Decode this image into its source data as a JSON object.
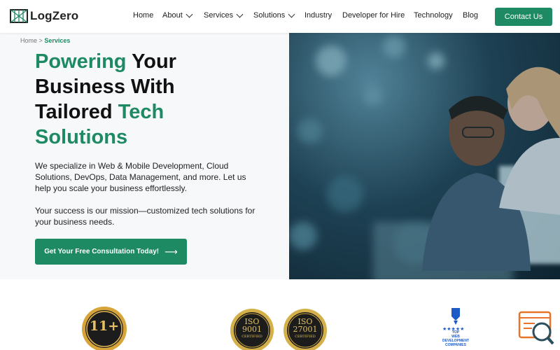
{
  "brand": {
    "name": "LogZero"
  },
  "nav": {
    "items": [
      {
        "label": "Home",
        "dropdown": false
      },
      {
        "label": "About",
        "dropdown": true
      },
      {
        "label": "Services",
        "dropdown": true
      },
      {
        "label": "Solutions",
        "dropdown": true
      },
      {
        "label": "Industry",
        "dropdown": false
      },
      {
        "label": "Developer for Hire",
        "dropdown": false
      },
      {
        "label": "Technology",
        "dropdown": false
      },
      {
        "label": "Blog",
        "dropdown": false
      }
    ],
    "contact_label": "Contact Us"
  },
  "breadcrumb": {
    "home": "Home",
    "separator": ">",
    "current": "Services"
  },
  "hero": {
    "headline": {
      "w1": "Powering",
      "w2": "Your",
      "w3": "Business With",
      "w4": "Tailored",
      "w5": "Tech",
      "w6": "Solutions"
    },
    "paragraph1": "We specialize in Web & Mobile Development, Cloud Solutions, DevOps, Data Management, and more. Let us help you scale your business effortlessly.",
    "paragraph2": "Your success is our mission—customized tech solutions for your business needs.",
    "cta_label": "Get Your Free Consultation Today!",
    "cta_arrow": "⟶"
  },
  "badges": {
    "years": {
      "text": "11+"
    },
    "iso1": {
      "line1": "ISO",
      "line2": "9001",
      "line3": "CERTIFIED"
    },
    "iso2": {
      "line1": "ISO",
      "line2": "27001",
      "line3": "CERTIFIED"
    },
    "top": {
      "line1": "TOP",
      "line2": "WEB DEVELOPMENT",
      "line3": "COMPANIES"
    }
  },
  "colors": {
    "accent": "#1e8a63",
    "text": "#111111",
    "hero_bg": "#f7f8fa"
  }
}
